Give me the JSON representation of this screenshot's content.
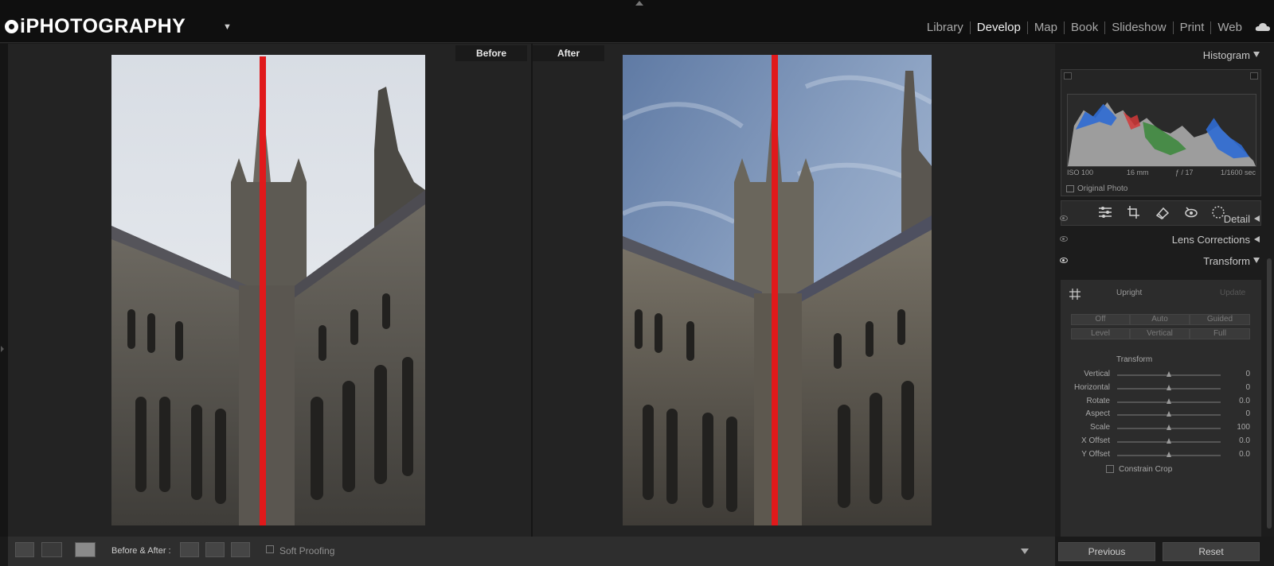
{
  "header": {
    "brand": "iPHOTOGRAPHY",
    "brand_caret": "▼",
    "modules": [
      "Library",
      "Develop",
      "Map",
      "Book",
      "Slideshow",
      "Print",
      "Web"
    ],
    "active_module": "Develop"
  },
  "view": {
    "before_label": "Before",
    "after_label": "After"
  },
  "panel": {
    "histogram": {
      "title": "Histogram",
      "iso": "ISO 100",
      "focal": "16 mm",
      "aperture": "ƒ / 17",
      "shutter": "1/1600 sec",
      "original_photo": "Original Photo"
    },
    "sections": {
      "detail": "Detail",
      "lens_corrections": "Lens Corrections",
      "transform": "Transform"
    },
    "upright": {
      "title": "Upright",
      "update": "Update",
      "buttons_row1": [
        "Off",
        "Auto",
        "Guided"
      ],
      "buttons_row2": [
        "Level",
        "Vertical",
        "Full"
      ]
    },
    "transform": {
      "subtitle": "Transform",
      "sliders": [
        {
          "label": "Vertical",
          "value": "0",
          "position": 0.5
        },
        {
          "label": "Horizontal",
          "value": "0",
          "position": 0.5
        },
        {
          "label": "Rotate",
          "value": "0.0",
          "position": 0.5
        },
        {
          "label": "Aspect",
          "value": "0",
          "position": 0.5
        },
        {
          "label": "Scale",
          "value": "100",
          "position": 0.5
        },
        {
          "label": "X Offset",
          "value": "0.0",
          "position": 0.5
        },
        {
          "label": "Y Offset",
          "value": "0.0",
          "position": 0.5
        }
      ],
      "constrain_crop": "Constrain Crop"
    }
  },
  "toolbar": {
    "before_after_label": "Before & After :",
    "soft_proofing": "Soft Proofing",
    "previous": "Previous",
    "reset": "Reset"
  }
}
